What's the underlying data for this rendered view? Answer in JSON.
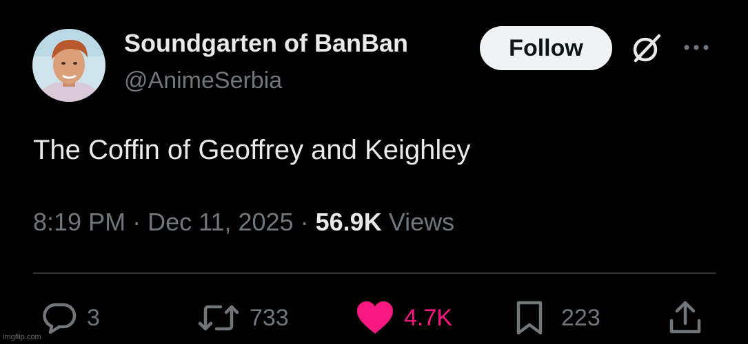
{
  "author": {
    "display_name": "Soundgarten of BanBan",
    "handle": "@AnimeSerbia"
  },
  "follow_label": "Follow",
  "tweet": {
    "text": "The Coffin of Geoffrey and Keighley"
  },
  "meta": {
    "time": "8:19 PM",
    "separator": "·",
    "date": "Dec 11, 2025",
    "views_count": "56.9K",
    "views_label": "Views"
  },
  "actions": {
    "replies": "3",
    "reposts": "733",
    "likes": "4.7K",
    "bookmarks": "223"
  },
  "colors": {
    "background": "#000000",
    "text": "#e7e9ea",
    "secondary": "#71767b",
    "like": "#f91880",
    "follow_bg": "#eff3f4"
  },
  "icons": [
    "reply-icon",
    "repost-icon",
    "like-icon",
    "bookmark-icon",
    "share-icon",
    "grok-icon",
    "more-icon"
  ],
  "watermark": "imgflip.com"
}
